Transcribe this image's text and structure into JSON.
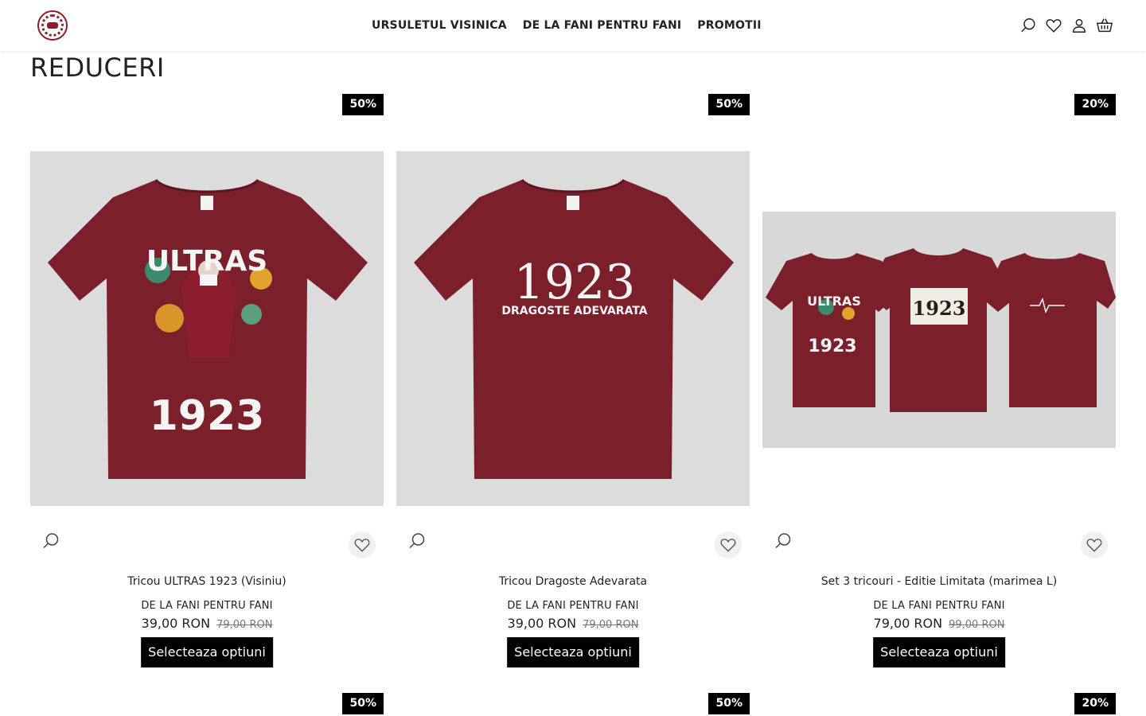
{
  "header": {
    "nav": [
      "URSULETUL VISINICA",
      "DE LA FANI PENTRU FANI",
      "PROMOTII"
    ]
  },
  "page": {
    "title": "REDUCERI"
  },
  "products": [
    {
      "badge": "50%",
      "name": "Tricou ULTRAS 1923 (Visiniu)",
      "category": "DE LA FANI PENTRU FANI",
      "price": "39,00 RON",
      "old_price": "79,00 RON",
      "button": "Selecteaza optiuni",
      "print_top": "ULTRAS",
      "print_bottom": "1923"
    },
    {
      "badge": "50%",
      "name": "Tricou Dragoste Adevarata",
      "category": "DE LA FANI PENTRU FANI",
      "price": "39,00 RON",
      "old_price": "79,00 RON",
      "button": "Selecteaza optiuni",
      "print_top": "1923",
      "print_bottom": "DRAGOSTE ADEVARATA"
    },
    {
      "badge": "20%",
      "name": "Set 3 tricouri - Editie Limitata (marimea L)",
      "category": "DE LA FANI PENTRU FANI",
      "price": "79,00 RON",
      "old_price": "99,00 RON",
      "button": "Selecteaza optiuni",
      "print_top": "ULTRAS",
      "print_bottom": "1923"
    }
  ],
  "next_row_badges": [
    "50%",
    "50%",
    "20%"
  ],
  "colors": {
    "accent": "#000000",
    "shirt": "#7b1f2b",
    "brand": "#8b1d2c"
  }
}
